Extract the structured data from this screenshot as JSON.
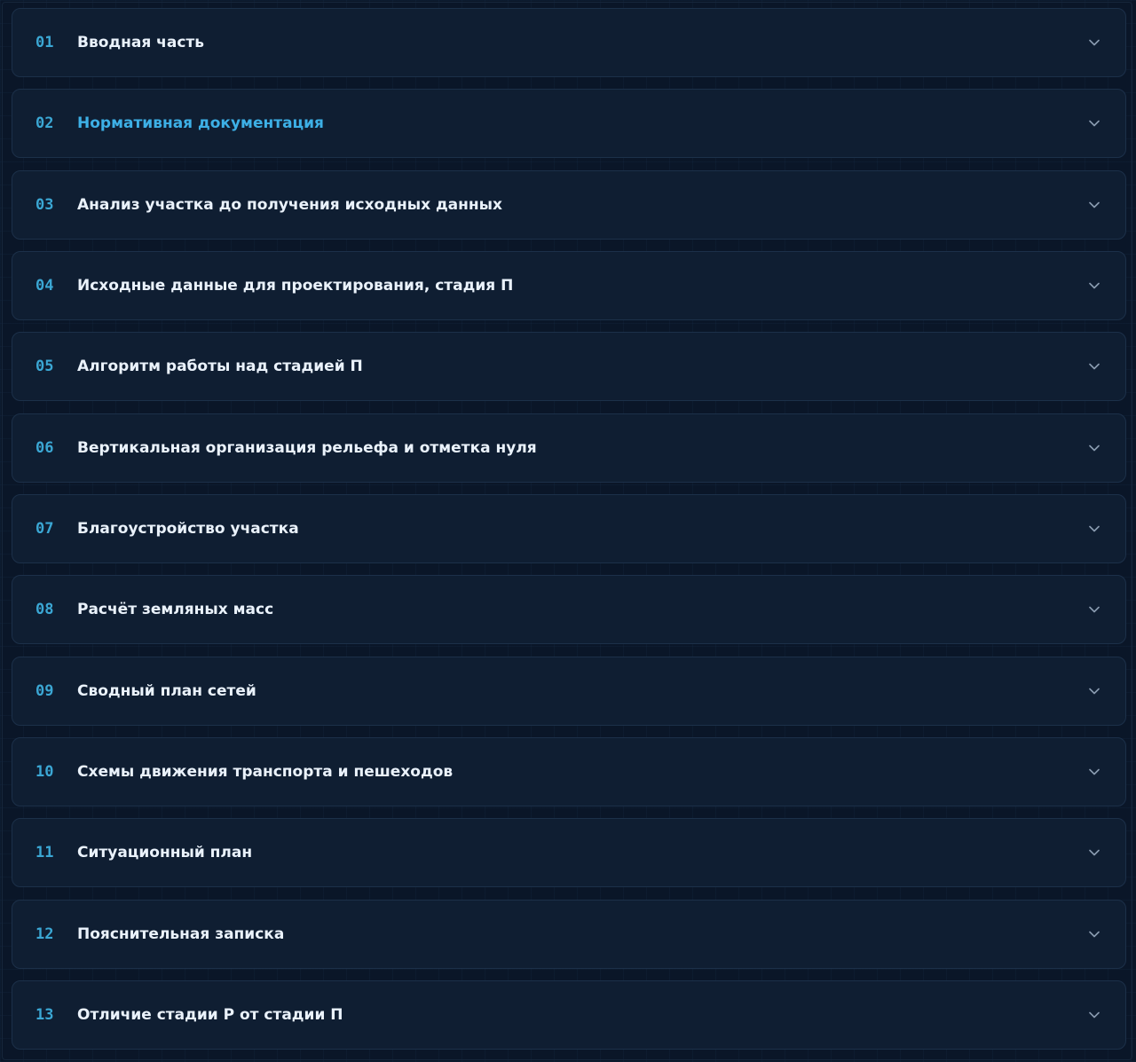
{
  "accordion": {
    "items": [
      {
        "number": "01",
        "title": "Вводная часть",
        "active": false
      },
      {
        "number": "02",
        "title": "Нормативная документация",
        "active": true
      },
      {
        "number": "03",
        "title": "Анализ участка до получения исходных данных",
        "active": false
      },
      {
        "number": "04",
        "title": "Исходные данные для проектирования, стадия П",
        "active": false
      },
      {
        "number": "05",
        "title": "Алгоритм работы над стадией П",
        "active": false
      },
      {
        "number": "06",
        "title": "Вертикальная организация рельефа и отметка нуля",
        "active": false
      },
      {
        "number": "07",
        "title": "Благоустройство участка",
        "active": false
      },
      {
        "number": "08",
        "title": "Расчёт земляных масс",
        "active": false
      },
      {
        "number": "09",
        "title": "Сводный план сетей",
        "active": false
      },
      {
        "number": "10",
        "title": "Схемы движения транспорта и пешеходов",
        "active": false
      },
      {
        "number": "11",
        "title": "Ситуационный план",
        "active": false
      },
      {
        "number": "12",
        "title": "Пояснительная записка",
        "active": false
      },
      {
        "number": "13",
        "title": "Отличие стадии Р от стадии П",
        "active": false
      }
    ],
    "expand_icon": "chevron-down-icon"
  },
  "colors": {
    "background": "#0a1628",
    "card": "#0f1e32",
    "card_border": "#1c3049",
    "number": "#3ba7d4",
    "title": "#eaf2fb",
    "title_active": "#3db0e6",
    "chevron": "#8a9bb0"
  }
}
